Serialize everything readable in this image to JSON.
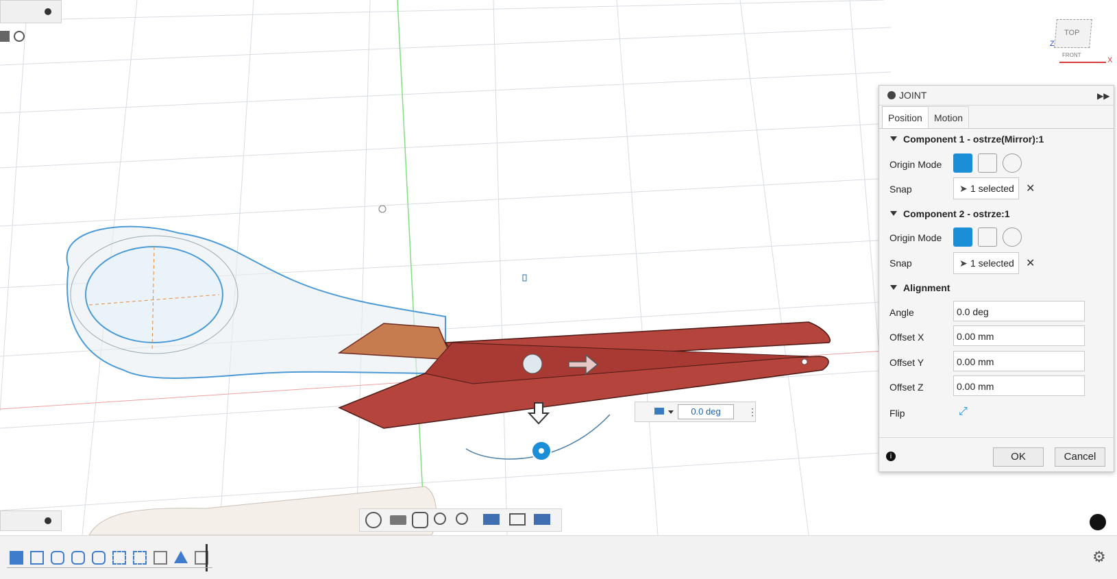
{
  "joint": {
    "title": "JOINT",
    "tabs": {
      "position": "Position",
      "motion": "Motion"
    },
    "component1": {
      "header": "Component 1 - ostrze(Mirror):1",
      "origin_mode_label": "Origin Mode",
      "snap_label": "Snap",
      "snap_value": "1 selected"
    },
    "component2": {
      "header": "Component 2 - ostrze:1",
      "origin_mode_label": "Origin Mode",
      "snap_label": "Snap",
      "snap_value": "1 selected"
    },
    "alignment": {
      "header": "Alignment",
      "angle_label": "Angle",
      "angle_value": "0.0 deg",
      "offset_x_label": "Offset X",
      "offset_x_value": "0.00 mm",
      "offset_y_label": "Offset Y",
      "offset_y_value": "0.00 mm",
      "offset_z_label": "Offset Z",
      "offset_z_value": "0.00 mm",
      "flip_label": "Flip"
    },
    "ok_label": "OK",
    "cancel_label": "Cancel"
  },
  "viewcube": {
    "top": "TOP",
    "front": "FRONT",
    "axis_x": "X",
    "axis_z": "Z"
  },
  "inline_angle": {
    "value": "0.0 deg"
  },
  "colors": {
    "accent": "#1a8fd8",
    "part": "#b5443c",
    "grid": "#d6dbe0"
  },
  "icons": [
    "collapse-icon",
    "expand-icon",
    "pin-icon",
    "info-icon",
    "flip-icon",
    "gear-icon",
    "pointer-icon",
    "clear-icon",
    "origin-mode-icon",
    "orbit-icon",
    "pan-icon",
    "zoom-icon",
    "display-settings-icon",
    "grid-icon",
    "viewports-icon"
  ]
}
